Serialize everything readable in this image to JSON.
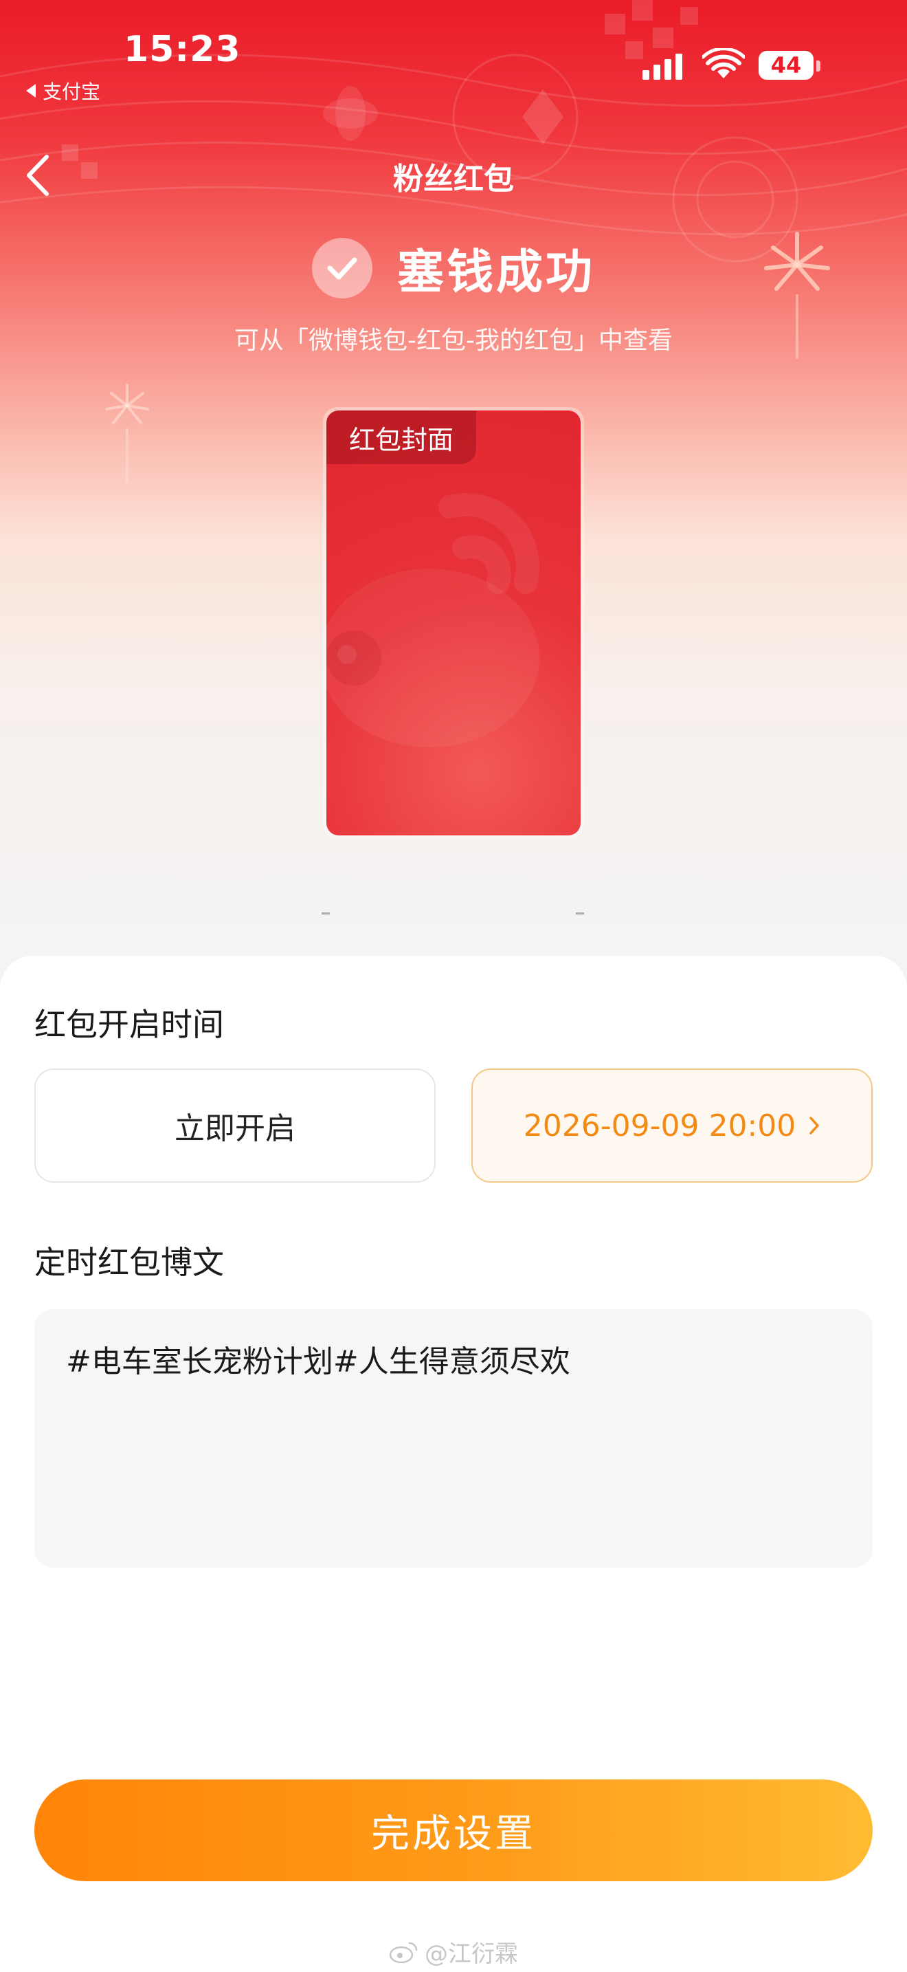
{
  "status_bar": {
    "time": "15:23",
    "back_app": "支付宝",
    "battery": "44"
  },
  "nav": {
    "title": "粉丝红包",
    "back_icon": "chevron-left-icon"
  },
  "success": {
    "title": "塞钱成功",
    "subtitle": "可从「微博钱包-红包-我的红包」中查看",
    "icon": "check-circle-icon"
  },
  "envelope": {
    "cover_label": "红包封面"
  },
  "open_time": {
    "label": "红包开启时间",
    "option_now": "立即开启",
    "option_scheduled": "2026-09-09 20:00"
  },
  "post": {
    "label": "定时红包博文",
    "text": "#电车室长宠粉计划#人生得意须尽欢"
  },
  "cta": {
    "label": "完成设置"
  },
  "watermark": {
    "text": "@江衍霖"
  },
  "colors": {
    "brand_red": "#ea1c28",
    "accent_orange": "#f28a14",
    "cta_start": "#ff8408",
    "cta_end": "#ffbb33"
  }
}
